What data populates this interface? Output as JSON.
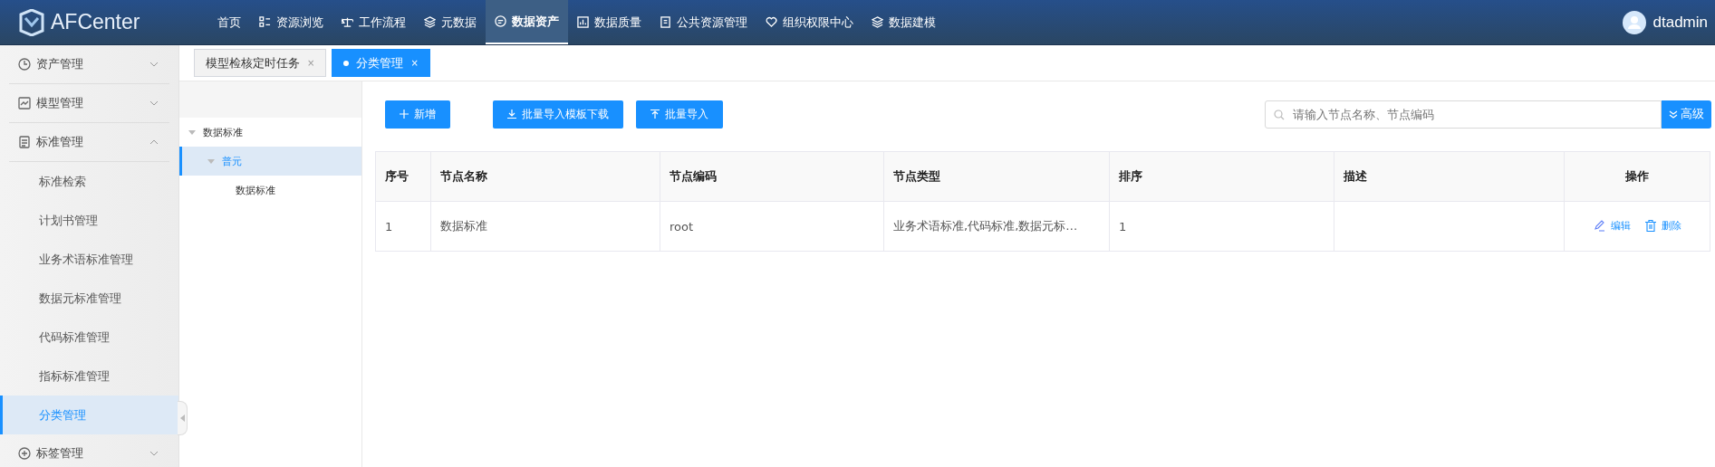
{
  "header": {
    "logo": "AFCenter",
    "nav": [
      {
        "label": "首页",
        "selected": false
      },
      {
        "label": "资源浏览",
        "selected": false
      },
      {
        "label": "工作流程",
        "selected": false
      },
      {
        "label": "元数据",
        "selected": false
      },
      {
        "label": "数据资产",
        "selected": true
      },
      {
        "label": "数据质量",
        "selected": false
      },
      {
        "label": "公共资源管理",
        "selected": false
      },
      {
        "label": "组织权限中心",
        "selected": false
      },
      {
        "label": "数据建模",
        "selected": false
      }
    ],
    "user": "dtadmin"
  },
  "sidebar": {
    "groups": [
      {
        "label": "资产管理",
        "expanded": false
      },
      {
        "label": "模型管理",
        "expanded": false
      },
      {
        "label": "标准管理",
        "expanded": true,
        "children": [
          {
            "label": "标准检索",
            "selected": false
          },
          {
            "label": "计划书管理",
            "selected": false
          },
          {
            "label": "业务术语标准管理",
            "selected": false
          },
          {
            "label": "数据元标准管理",
            "selected": false
          },
          {
            "label": "代码标准管理",
            "selected": false
          },
          {
            "label": "指标标准管理",
            "selected": false
          },
          {
            "label": "分类管理",
            "selected": true
          }
        ]
      },
      {
        "label": "标签管理",
        "expanded": false
      }
    ]
  },
  "tabs": [
    {
      "label": "模型检核定时任务",
      "selected": false,
      "close": "×"
    },
    {
      "label": "分类管理",
      "selected": true,
      "close": "×"
    }
  ],
  "tree": [
    {
      "label": "数据标准",
      "expanded": true,
      "selected": false,
      "children": [
        {
          "label": "普元",
          "expanded": true,
          "selected": true,
          "children": [
            {
              "label": "数据标准",
              "selected": false
            }
          ]
        }
      ]
    }
  ],
  "toolbar": {
    "buttons": [
      "新增",
      "批量导入模板下载",
      "批量导入"
    ],
    "search": {
      "placeholder": "请输入节点名称、节点编码"
    },
    "advanced": "高级"
  },
  "table": {
    "columns": [
      "序号",
      "节点名称",
      "节点编码",
      "节点类型",
      "排序",
      "描述",
      "操作"
    ],
    "rows": [
      {
        "cells": [
          "1",
          "数据标准",
          "root",
          "业务术语标准,代码标准,数据元标…",
          "1",
          ""
        ],
        "actions": [
          "编辑",
          "删除"
        ]
      }
    ]
  }
}
